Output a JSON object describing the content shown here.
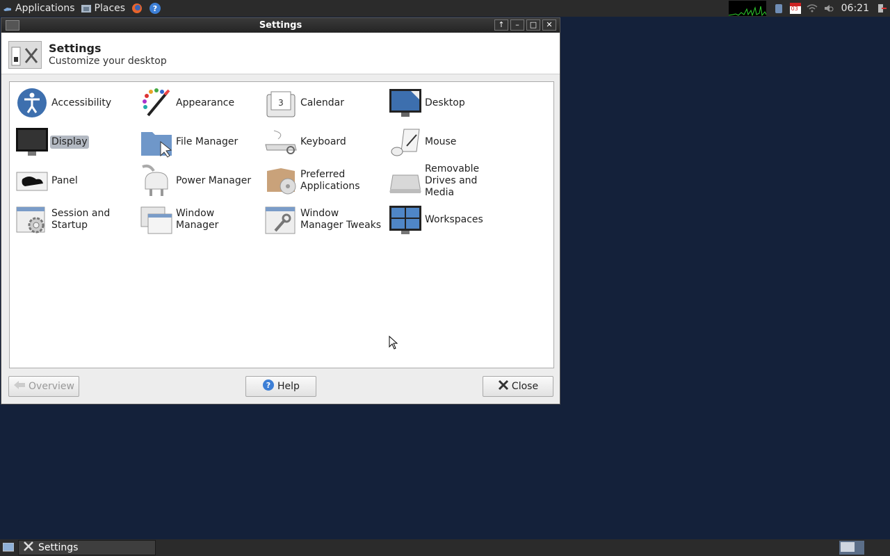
{
  "top_panel": {
    "applications_label": "Applications",
    "places_label": "Places",
    "clock": "06:21",
    "calendar_day": "03"
  },
  "window": {
    "title": "Settings",
    "header_title": "Settings",
    "header_subtitle": "Customize your desktop"
  },
  "items": [
    {
      "label": "Accessibility",
      "icon": "accessibility-icon"
    },
    {
      "label": "Appearance",
      "icon": "appearance-icon"
    },
    {
      "label": "Calendar",
      "icon": "calendar-icon"
    },
    {
      "label": "Desktop",
      "icon": "desktop-icon"
    },
    {
      "label": "Display",
      "icon": "display-icon"
    },
    {
      "label": "File Manager",
      "icon": "file-manager-icon"
    },
    {
      "label": "Keyboard",
      "icon": "keyboard-icon"
    },
    {
      "label": "Mouse",
      "icon": "mouse-icon"
    },
    {
      "label": "Panel",
      "icon": "panel-icon"
    },
    {
      "label": "Power Manager",
      "icon": "power-manager-icon"
    },
    {
      "label": "Preferred Applications",
      "icon": "preferred-applications-icon"
    },
    {
      "label": "Removable Drives and Media",
      "icon": "removable-drives-icon"
    },
    {
      "label": "Session and Startup",
      "icon": "session-startup-icon"
    },
    {
      "label": "Window Manager",
      "icon": "window-manager-icon"
    },
    {
      "label": "Window Manager Tweaks",
      "icon": "window-manager-tweaks-icon"
    },
    {
      "label": "Workspaces",
      "icon": "workspaces-icon"
    }
  ],
  "selected_item": "Display",
  "buttons": {
    "overview": "Overview",
    "help": "Help",
    "close": "Close"
  },
  "taskbar": {
    "task_label": "Settings"
  }
}
